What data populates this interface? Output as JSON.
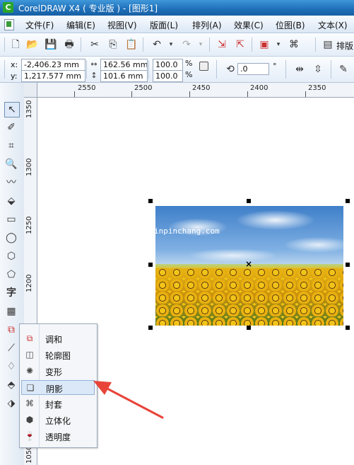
{
  "app": {
    "title": "CorelDRAW X4 ( 专业版 ) - [图形1]",
    "app_icon_glyph": "C",
    "accent": "#1e6fb8"
  },
  "menubar": {
    "items": [
      "文件(F)",
      "编辑(E)",
      "视图(V)",
      "版面(L)",
      "排列(A)",
      "效果(C)",
      "位图(B)",
      "文本(X)"
    ]
  },
  "toolbar1": {
    "right_label": "排版"
  },
  "propbar": {
    "x_label": "x:",
    "y_label": "y:",
    "x_value": "-2,406.23 mm",
    "y_value": "1,217.577 mm",
    "width_value": "162.56 mm",
    "height_value": "101.6 mm",
    "scale_x": "100.0",
    "scale_y": "100.0",
    "percent": "%",
    "rotation": ".0",
    "degree": "°"
  },
  "ruler_h": {
    "labels": [
      "2550",
      "2500",
      "2450",
      "2400",
      "2350"
    ]
  },
  "ruler_v": {
    "labels": [
      "1350",
      "1300",
      "1250",
      "1200",
      "1050"
    ]
  },
  "canvas": {
    "watermark": "inpinchang.com",
    "center_mark": "×"
  },
  "toolbox": {
    "text_tool_glyph": "字"
  },
  "flyout": {
    "items": [
      {
        "label": "调和",
        "icon": "blend-icon"
      },
      {
        "label": "轮廓图",
        "icon": "contour-icon"
      },
      {
        "label": "变形",
        "icon": "distort-icon"
      },
      {
        "label": "阴影",
        "icon": "drop-shadow-icon"
      },
      {
        "label": "封套",
        "icon": "envelope-icon"
      },
      {
        "label": "立体化",
        "icon": "extrude-icon"
      },
      {
        "label": "透明度",
        "icon": "transparency-icon"
      }
    ],
    "highlighted": "阴影"
  },
  "annotation": {
    "arrow_color": "#e8443a"
  }
}
